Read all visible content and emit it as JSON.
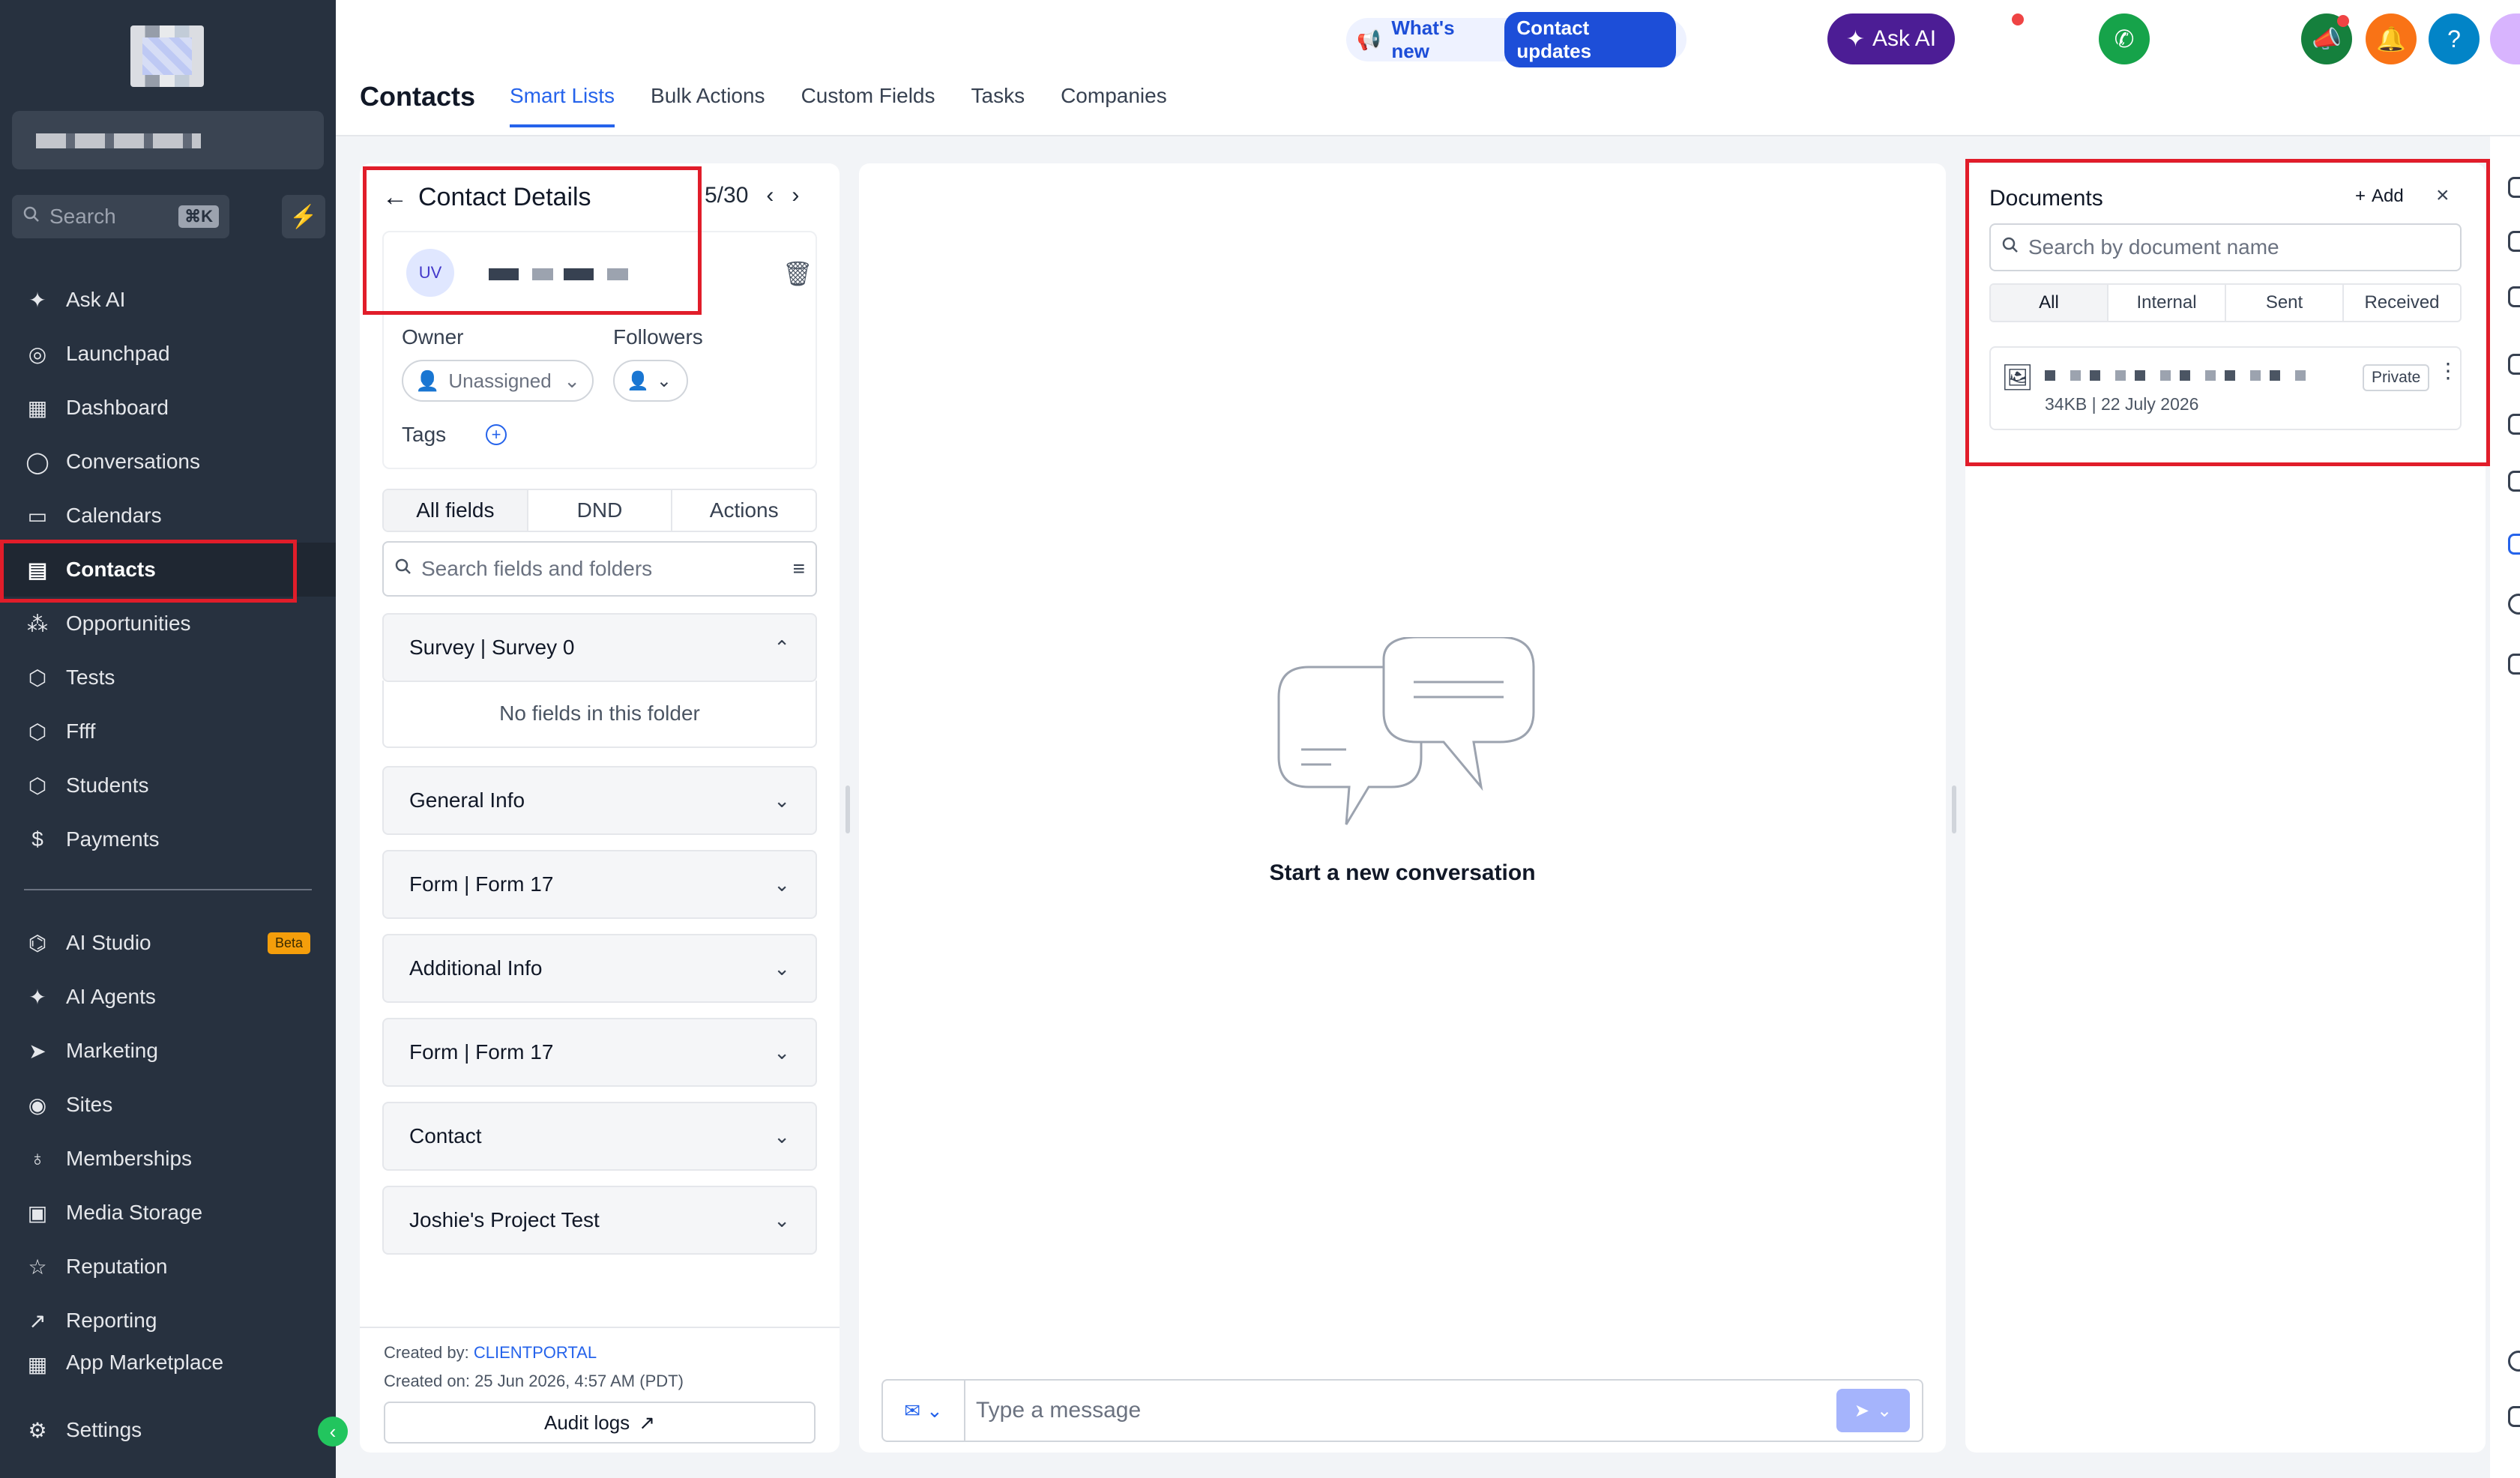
{
  "sidebar": {
    "search_placeholder": "Search",
    "search_shortcut": "⌘K",
    "items_top": [
      {
        "label": "Ask AI",
        "icon": "sparkle-icon"
      },
      {
        "label": "Launchpad",
        "icon": "rocket-icon"
      },
      {
        "label": "Dashboard",
        "icon": "grid-icon"
      },
      {
        "label": "Conversations",
        "icon": "chat-bubble-icon"
      },
      {
        "label": "Calendars",
        "icon": "calendar-icon"
      },
      {
        "label": "Contacts",
        "icon": "contact-book-icon"
      },
      {
        "label": "Opportunities",
        "icon": "network-icon"
      },
      {
        "label": "Tests",
        "icon": "cube-icon"
      },
      {
        "label": "Ffff",
        "icon": "cube-icon"
      },
      {
        "label": "Students",
        "icon": "cube-icon"
      },
      {
        "label": "Payments",
        "icon": "receipt-icon"
      }
    ],
    "items_bottom": [
      {
        "label": "AI Studio",
        "icon": "ai-studio-icon",
        "badge": "Beta"
      },
      {
        "label": "AI Agents",
        "icon": "sparkle-icon"
      },
      {
        "label": "Marketing",
        "icon": "send-icon"
      },
      {
        "label": "Sites",
        "icon": "globe-icon"
      },
      {
        "label": "Memberships",
        "icon": "award-icon"
      },
      {
        "label": "Media Storage",
        "icon": "image-icon"
      },
      {
        "label": "Reputation",
        "icon": "star-icon"
      },
      {
        "label": "Reporting",
        "icon": "trend-icon"
      },
      {
        "label": "App Marketplace",
        "icon": "apps-icon"
      }
    ],
    "settings_label": "Settings"
  },
  "header": {
    "whats_new": "What's new",
    "contact_updates": "Contact updates",
    "ask_ai": "Ask AI",
    "help": "?"
  },
  "page": {
    "title": "Contacts",
    "tabs": [
      "Smart Lists",
      "Bulk Actions",
      "Custom Fields",
      "Tasks",
      "Companies"
    ]
  },
  "contact": {
    "panel_title": "Contact Details",
    "pager": "5/30",
    "initials": "UV",
    "owner_label": "Owner",
    "owner_value": "Unassigned",
    "followers_label": "Followers",
    "tags_label": "Tags",
    "segments": [
      "All fields",
      "DND",
      "Actions"
    ],
    "fields_search_placeholder": "Search fields and folders",
    "folders": [
      {
        "name": "Survey | Survey 0",
        "expanded": true,
        "empty_text": "No fields in this folder"
      },
      {
        "name": "General Info"
      },
      {
        "name": "Form | Form 17"
      },
      {
        "name": "Additional Info"
      },
      {
        "name": "Form | Form 17"
      },
      {
        "name": "Contact"
      },
      {
        "name": "Joshie's Project Test"
      }
    ],
    "created_by_label": "Created by:",
    "created_by_value": "CLIENTPORTAL",
    "created_on": "Created on: 25 Jun 2026, 4:57 AM (PDT)",
    "audit_logs": "Audit logs"
  },
  "conversation": {
    "empty_text": "Start a new conversation",
    "message_placeholder": "Type a message"
  },
  "documents": {
    "title": "Documents",
    "add_label": "Add",
    "search_placeholder": "Search by document name",
    "filters": [
      "All",
      "Internal",
      "Sent",
      "Received"
    ],
    "items": [
      {
        "meta": "34KB | 22 July 2026",
        "badge": "Private"
      }
    ]
  },
  "colors": {
    "sidebar_bg": "#27313f",
    "accent": "#2563eb",
    "highlight_box": "#e11d2a",
    "ask_ai_bg": "#4c1d95"
  }
}
